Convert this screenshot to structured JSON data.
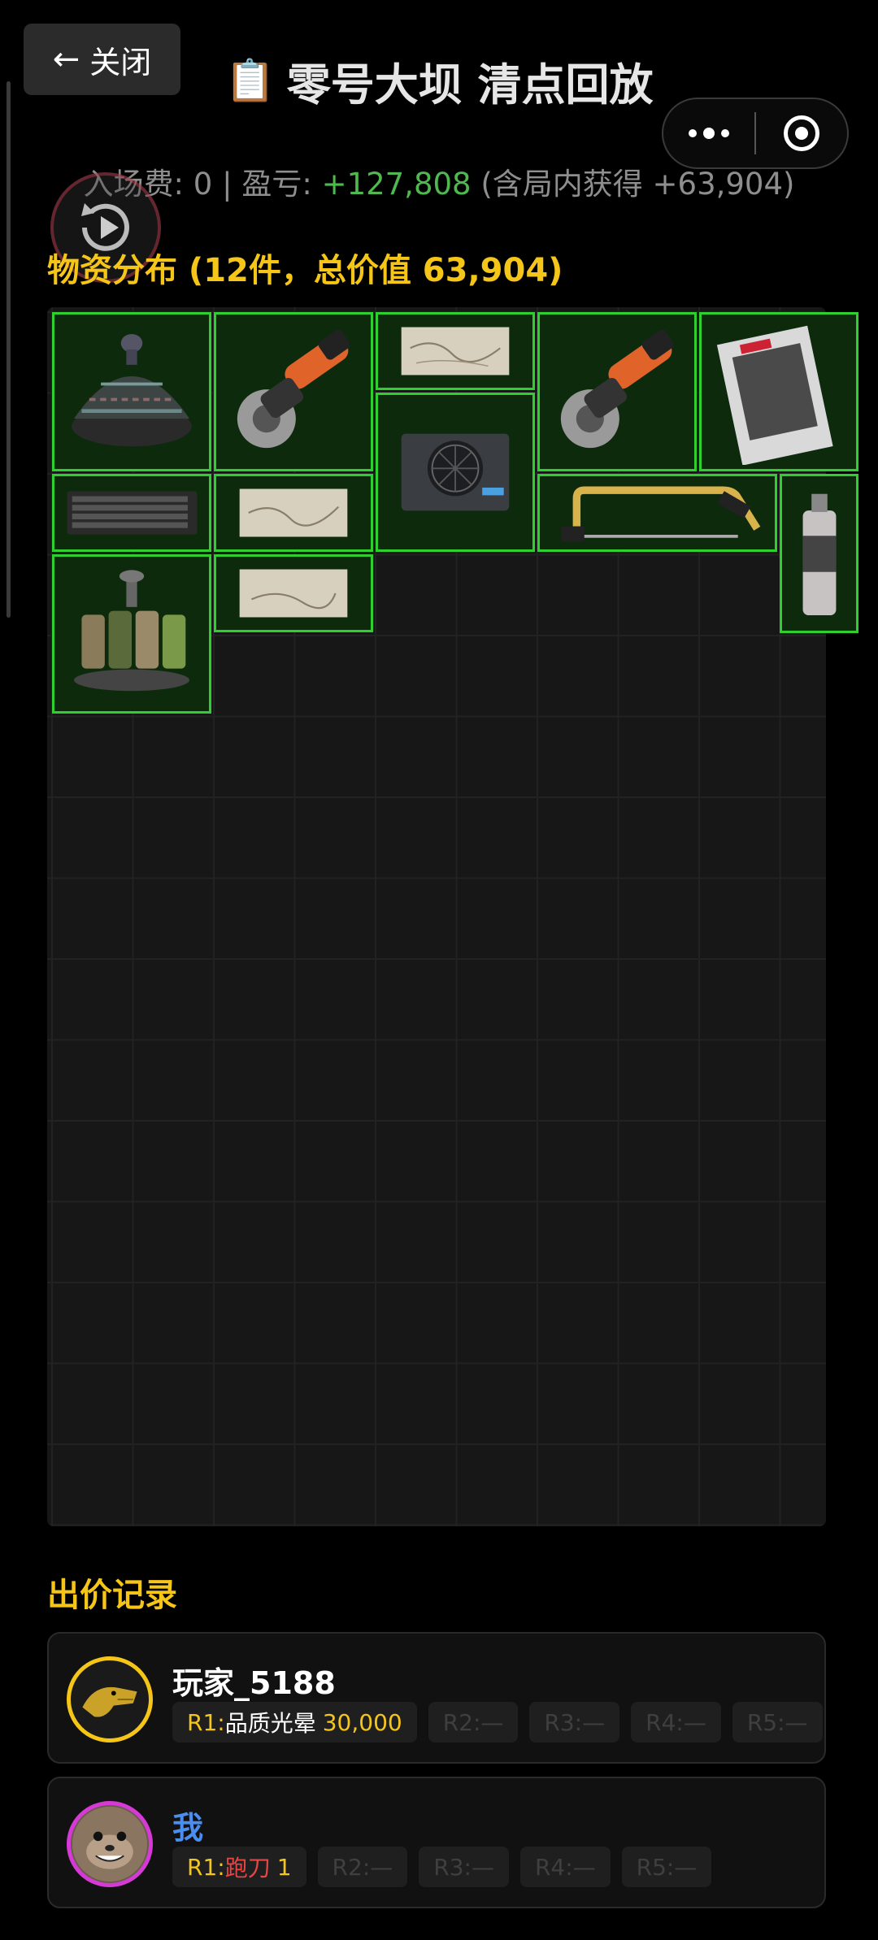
{
  "header": {
    "close_arrow": "←",
    "close_label": "关闭",
    "title_icon": "📋",
    "title": "零号大坝 清点回放"
  },
  "summary": {
    "entry_prefix": "入场费: ",
    "entry_fee": "0",
    "sep": " | ",
    "profit_prefix": "盈亏: ",
    "profit": "+127,808",
    "gain_text": " (含局内获得 +63,904)"
  },
  "distribution": {
    "title": "物资分布 (12件，总价值 63,904)",
    "items": [
      {
        "name": "tagine-pot-icon"
      },
      {
        "name": "angle-grinder-icon"
      },
      {
        "name": "old-map-icon"
      },
      {
        "name": "angle-grinder-icon"
      },
      {
        "name": "magazine-icon"
      },
      {
        "name": "power-supply-icon"
      },
      {
        "name": "keyboard-icon"
      },
      {
        "name": "old-map-icon"
      },
      {
        "name": "hacksaw-icon"
      },
      {
        "name": "spray-can-icon"
      },
      {
        "name": "spice-rack-icon"
      },
      {
        "name": "old-map-icon"
      }
    ]
  },
  "bids": {
    "title": "出价记录",
    "records": [
      {
        "player": "玩家_5188",
        "name_color": "#ffffff",
        "avatar": "golden-crocodile-avatar",
        "r1_label": "R1:",
        "r1_item": "品质光晕",
        "r1_amount": "30,000",
        "r2": "R2:—",
        "r3": "R3:—",
        "r4": "R4:—",
        "r5": "R5:—"
      },
      {
        "player": "我",
        "name_color": "#4a8ef0",
        "avatar": "otter-avatar",
        "r1_label": "R1:",
        "r1_item": "跑刀",
        "r1_amount": "1",
        "r2": "R2:—",
        "r3": "R3:—",
        "r4": "R4:—",
        "r5": "R5:—"
      }
    ]
  },
  "colors": {
    "accent_gold": "#f5c518",
    "profit_green": "#4fb84f",
    "item_border": "#2fcf2f",
    "item_bg": "#0d2a0d"
  }
}
